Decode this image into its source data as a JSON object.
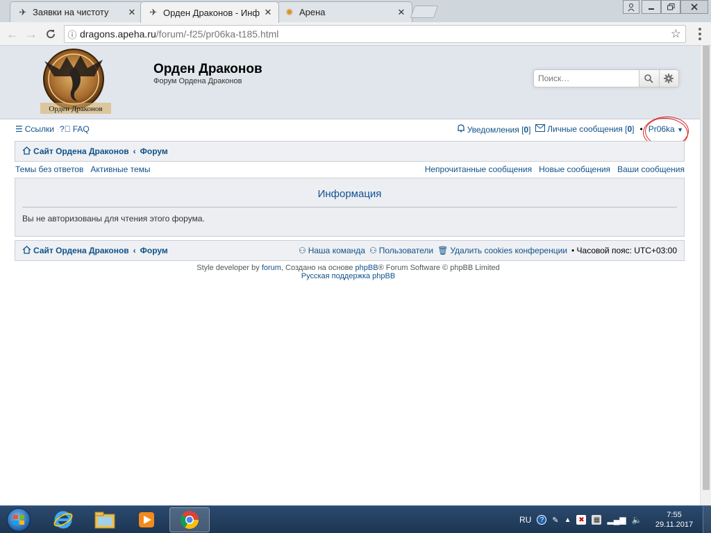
{
  "browser": {
    "tabs": [
      {
        "title": "Заявки на чистоту",
        "active": false
      },
      {
        "title": "Орден Драконов - Инф",
        "active": true
      },
      {
        "title": "Арена",
        "active": false
      }
    ],
    "url_host": "dragons.apeha.ru",
    "url_path": "/forum/-f25/pr06ka-t185.html"
  },
  "header": {
    "logo_text": "Орден Драконов",
    "site_title": "Орден Драконов",
    "site_description": "Форум Ордена Драконов",
    "search_placeholder": "Поиск…"
  },
  "navbar": {
    "links_label": "Ссылки",
    "faq_label": "FAQ",
    "notifications_label": "Уведомления",
    "notifications_count": "0",
    "messages_label": "Личные сообщения",
    "messages_count": "0",
    "username": "Pr06ka"
  },
  "breadcrumbs": {
    "site": "Сайт Ордена Драконов",
    "forum": "Форум"
  },
  "quicklinks": {
    "unanswered": "Темы без ответов",
    "active": "Активные темы",
    "unread": "Непрочитанные сообщения",
    "new_posts": "Новые сообщения",
    "your_posts": "Ваши сообщения"
  },
  "info": {
    "heading": "Информация",
    "message": "Вы не авторизованы для чтения этого форума."
  },
  "footer": {
    "team": "Наша команда",
    "members": "Пользователи",
    "delete_cookies": "Удалить cookies конференции",
    "timezone_label": "Часовой пояс:",
    "timezone_value": "UTC+03:00",
    "credit_prefix": "Style developer by",
    "credit_forum": "forum",
    "credit_middle": ", Создано на основе",
    "credit_phpbb": "phpBB",
    "credit_suffix": "® Forum Software © phpBB Limited",
    "russian_support": "Русская поддержка phpBB"
  },
  "taskbar": {
    "language": "RU",
    "time": "7:55",
    "date": "29.11.2017"
  },
  "colors": {
    "link": "#105289",
    "header_bg": "#e1e6ec",
    "panel_bg": "#eceef1",
    "highlight_circle": "#d92020"
  }
}
